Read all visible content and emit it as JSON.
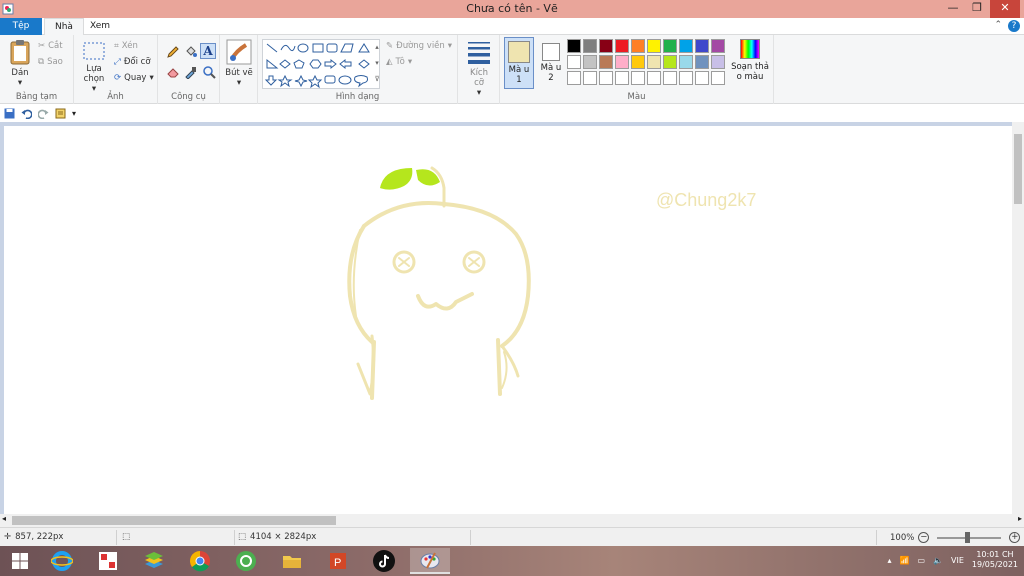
{
  "window": {
    "title": "Chưa có tên - Vẽ",
    "buttons": {
      "minimize": "—",
      "restore": "❐",
      "close": "✕"
    }
  },
  "tabs": {
    "file": "Tệp",
    "home": "Nhà",
    "view": "Xem"
  },
  "ribbon": {
    "clipboard": {
      "label": "Bảng tạm",
      "paste": "Dán",
      "cut": "Cắt",
      "copy": "Sao"
    },
    "image": {
      "label": "Ảnh",
      "select": "Lựa chọn",
      "crop": "Xén",
      "resize": "Đổi cỡ",
      "rotate": "Quay"
    },
    "tools": {
      "label": "Công cụ"
    },
    "brushes": {
      "label": "Bút vẽ"
    },
    "shapes": {
      "label": "Hình dạng",
      "outline": "Đường viền",
      "fill": "Tô"
    },
    "size": {
      "label": "Kích cỡ"
    },
    "colors": {
      "label": "Màu",
      "color1": "Mà u 1",
      "color2": "Mà u 2",
      "edit": "Soạn thả o màu",
      "color1_value": "#efe4b0",
      "color2_value": "#ffffff",
      "palette_row1": [
        "#000000",
        "#7f7f7f",
        "#880015",
        "#ed1c24",
        "#ff7f27",
        "#fff200",
        "#22b14c",
        "#00a2e8",
        "#3f48cc",
        "#a349a4"
      ],
      "palette_row2": [
        "#ffffff",
        "#c3c3c3",
        "#b97a57",
        "#ffaec9",
        "#ffc90e",
        "#efe4b0",
        "#b5e61d",
        "#99d9ea",
        "#7092be",
        "#c8bfe7"
      ],
      "palette_row3": [
        "#ffffff",
        "#ffffff",
        "#ffffff",
        "#ffffff",
        "#ffffff",
        "#ffffff",
        "#ffffff",
        "#ffffff",
        "#ffffff",
        "#ffffff"
      ]
    }
  },
  "canvas": {
    "watermark": "@Chung2k7",
    "drawing_color": "#efe4b0",
    "leaf_color": "#b5e61d"
  },
  "status": {
    "cursor": "857, 222px",
    "image_size": "4104 × 2824px",
    "zoom": "100%"
  },
  "taskbar": {
    "language": "VIE",
    "time": "10:01 CH",
    "date": "19/05/2021"
  }
}
